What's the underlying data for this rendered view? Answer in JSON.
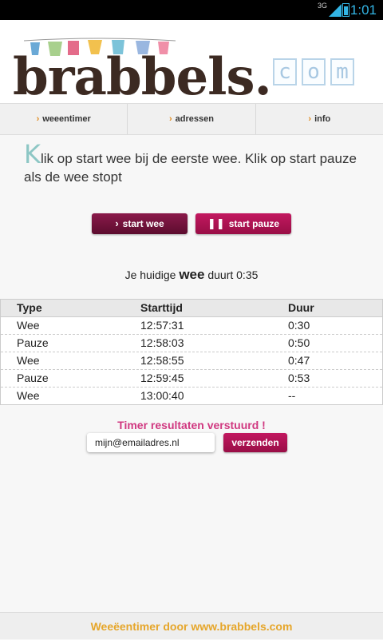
{
  "statusbar": {
    "network": "3G",
    "time": "1:01"
  },
  "logo": {
    "main": "brabbels.",
    "com": [
      "c",
      "o",
      "m"
    ]
  },
  "nav": [
    {
      "label": "weeentimer"
    },
    {
      "label": "adressen"
    },
    {
      "label": "info"
    }
  ],
  "intro": {
    "first_letter": "K",
    "rest": "lik op start wee bij de eerste wee. Klik op start pauze als de wee stopt"
  },
  "buttons": {
    "start_wee": "start wee",
    "start_pauze": "start pauze",
    "send": "verzenden"
  },
  "current": {
    "prefix": "Je huidige",
    "type": "wee",
    "suffix": "duurt 0:35"
  },
  "table": {
    "headers": [
      "Type",
      "Starttijd",
      "Duur"
    ],
    "rows": [
      [
        "Wee",
        "12:57:31",
        "0:30"
      ],
      [
        "Pauze",
        "12:58:03",
        "0:50"
      ],
      [
        "Wee",
        "12:58:55",
        "0:47"
      ],
      [
        "Pauze",
        "12:59:45",
        "0:53"
      ],
      [
        "Wee",
        "13:00:40",
        "--"
      ]
    ]
  },
  "email": {
    "status": "Timer resultaten verstuurd !",
    "value": "mijn@emailadres.nl"
  },
  "footer": {
    "text": "Weeëentimer door www.brabbels.com"
  },
  "colors": {
    "brand_dark": "#5c0c2e",
    "brand_pink": "#c21860",
    "accent_orange": "#e6a62a",
    "status_pink": "#d03880"
  }
}
